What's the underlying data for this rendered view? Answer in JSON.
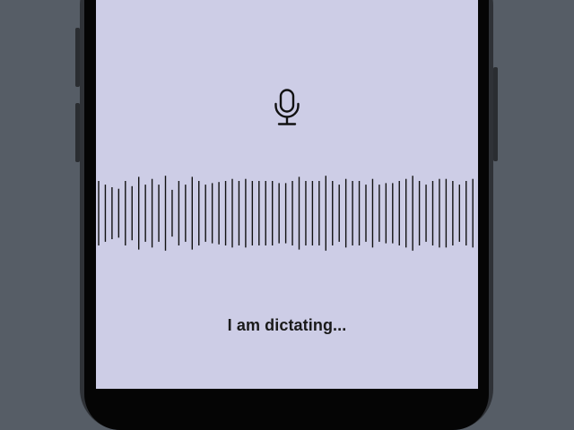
{
  "dictation": {
    "status_text": "I am dictating...",
    "mic_icon": "microphone-icon",
    "waveform_levels": [
      0.62,
      0.55,
      0.5,
      0.47,
      0.62,
      0.52,
      0.7,
      0.55,
      0.66,
      0.55,
      0.72,
      0.45,
      0.62,
      0.55,
      0.7,
      0.62,
      0.55,
      0.58,
      0.6,
      0.62,
      0.66,
      0.62,
      0.66,
      0.62,
      0.62,
      0.62,
      0.62,
      0.58,
      0.58,
      0.62,
      0.7,
      0.62,
      0.62,
      0.62,
      0.72,
      0.62,
      0.55,
      0.66,
      0.62,
      0.62,
      0.55,
      0.66,
      0.55,
      0.58,
      0.58,
      0.62,
      0.66,
      0.72,
      0.62,
      0.55,
      0.62,
      0.66,
      0.66,
      0.62,
      0.55,
      0.62,
      0.66
    ]
  },
  "colors": {
    "background": "#565d66",
    "screen": "#cdcde6",
    "bar": "#111111",
    "text": "#1a1a1a"
  }
}
